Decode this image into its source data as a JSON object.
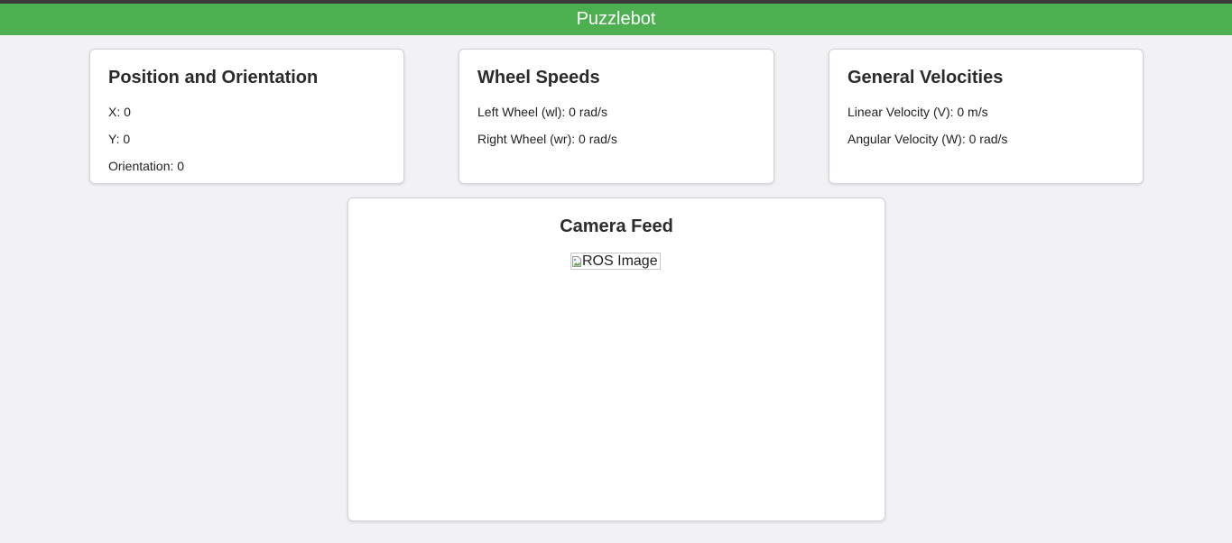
{
  "header": {
    "title": "Puzzlebot"
  },
  "position_card": {
    "title": "Position and Orientation",
    "x_text": "X: 0",
    "y_text": "Y: 0",
    "orientation_text": "Orientation: 0"
  },
  "wheel_card": {
    "title": "Wheel Speeds",
    "left_text": "Left Wheel (wl): 0 rad/s",
    "right_text": "Right Wheel (wr): 0 rad/s"
  },
  "velocity_card": {
    "title": "General Velocities",
    "linear_text": "Linear Velocity (V): 0 m/s",
    "angular_text": "Angular Velocity (W): 0 rad/s"
  },
  "camera_card": {
    "title": "Camera Feed",
    "image_alt": "ROS Image",
    "image_icon": "broken-image-icon"
  },
  "colors": {
    "header": "#4caf50",
    "background": "#f2f2f5",
    "card": "#ffffff"
  }
}
